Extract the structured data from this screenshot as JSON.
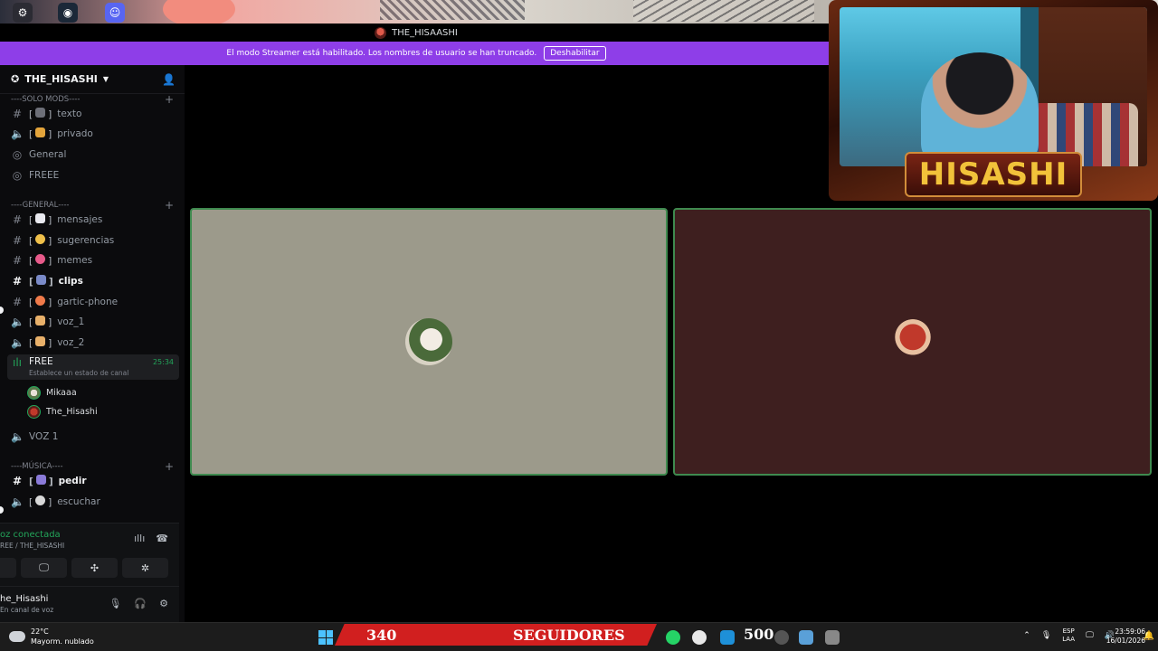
{
  "window": {
    "title": "THE_HISAASHI"
  },
  "banner": {
    "text": "El modo Streamer está habilitado. Los nombres de usuario se han truncado.",
    "button": "Deshabilitar"
  },
  "server": {
    "name": "THE_HISASHI"
  },
  "categories": [
    {
      "label": "----SOLO MODS----"
    },
    {
      "label": "----GENERAL----"
    },
    {
      "label": "----MÚSICA----"
    }
  ],
  "channels": [
    {
      "name": "texto",
      "type": "text"
    },
    {
      "name": "privado",
      "type": "voice"
    },
    {
      "name": "General",
      "type": "stage"
    },
    {
      "name": "FREEE",
      "type": "stage"
    },
    {
      "name": "mensajes",
      "type": "text"
    },
    {
      "name": "sugerencias",
      "type": "text"
    },
    {
      "name": "memes",
      "type": "text"
    },
    {
      "name": "clips",
      "type": "text",
      "unread": true
    },
    {
      "name": "gartic-phone",
      "type": "text"
    },
    {
      "name": "voz_1",
      "type": "voice"
    },
    {
      "name": "voz_2",
      "type": "voice"
    },
    {
      "name": "VOZ 1",
      "type": "voice"
    },
    {
      "name": "pedir",
      "type": "text",
      "unread": true
    },
    {
      "name": "escuchar",
      "type": "voice"
    }
  ],
  "active_channel": {
    "name": "FREE",
    "status": "Establece un estado de canal",
    "timer": "25:34"
  },
  "members": [
    {
      "name": "Mikaaa"
    },
    {
      "name": "The_Hisashi"
    }
  ],
  "voice_panel": {
    "status": "oz conectada",
    "location": "REE / THE_HISASHI"
  },
  "user_panel": {
    "name": "he_Hisashi",
    "status": "En canal de voz"
  },
  "overlay": {
    "cam_name": "HISASHI",
    "followers": "340",
    "followers_label": "SEGUIDORES",
    "goal": "500"
  },
  "taskbar": {
    "weather_temp": "22°C",
    "weather_desc": "Mayorm. nublado",
    "lang_1": "ESP",
    "lang_2": "LAA",
    "time": "23:59:06",
    "date": "16/01/2026"
  },
  "colors": {
    "accent": "#8e3ee8",
    "speaking": "#3f8a4f",
    "tile_left": "#9c9a8b",
    "tile_right": "#3e1f1f",
    "ribbon": "#d11f1f"
  }
}
